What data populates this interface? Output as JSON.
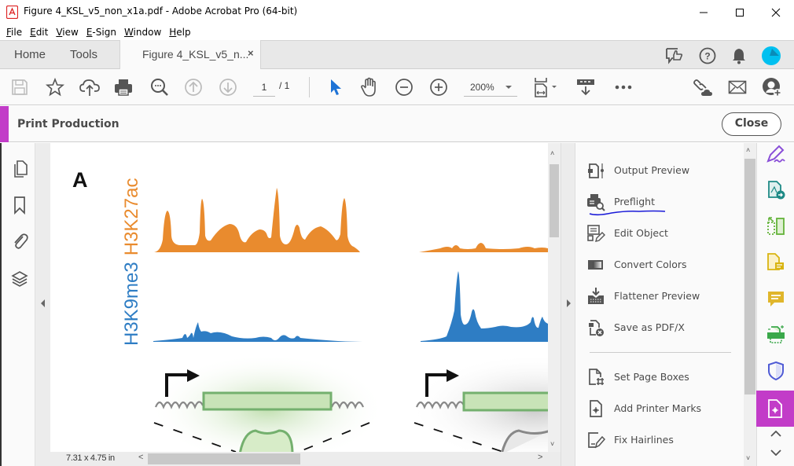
{
  "window": {
    "title": "Figure 4_KSL_v5_non_x1a.pdf - Adobe Acrobat Pro (64-bit)",
    "controls": [
      "minimize",
      "maximize",
      "close"
    ]
  },
  "menubar": [
    "File",
    "Edit",
    "View",
    "E-Sign",
    "Window",
    "Help"
  ],
  "tabs": {
    "home": "Home",
    "tools": "Tools",
    "document": "Figure 4_KSL_v5_n...",
    "close_glyph": "×"
  },
  "toolbar": {
    "page_current": "1",
    "page_total": "/  1",
    "zoom": "200%"
  },
  "print_production": {
    "title": "Print Production",
    "close_label": "Close",
    "accent_color": "#c23cc8",
    "tools": [
      {
        "label": "Output Preview",
        "icon": "output-preview-icon"
      },
      {
        "label": "Preflight",
        "icon": "preflight-icon",
        "annotated": true
      },
      {
        "label": "Edit Object",
        "icon": "edit-object-icon"
      },
      {
        "label": "Convert Colors",
        "icon": "convert-colors-icon"
      },
      {
        "label": "Flattener Preview",
        "icon": "flattener-preview-icon"
      },
      {
        "label": "Save as PDF/X",
        "icon": "save-pdfx-icon"
      },
      {
        "label": "Set Page Boxes",
        "icon": "set-page-boxes-icon"
      },
      {
        "label": "Add Printer Marks",
        "icon": "add-printer-marks-icon"
      },
      {
        "label": "Fix Hairlines",
        "icon": "fix-hairlines-icon"
      }
    ]
  },
  "document": {
    "panel_letter": "A",
    "label_orange": "H3K27ac",
    "label_blue": "H3K9me3",
    "orange": "#e98b2e",
    "blue": "#2e7dc4",
    "gene_green": "#74b06e",
    "page_size": "7.31 x 4.75 in"
  }
}
